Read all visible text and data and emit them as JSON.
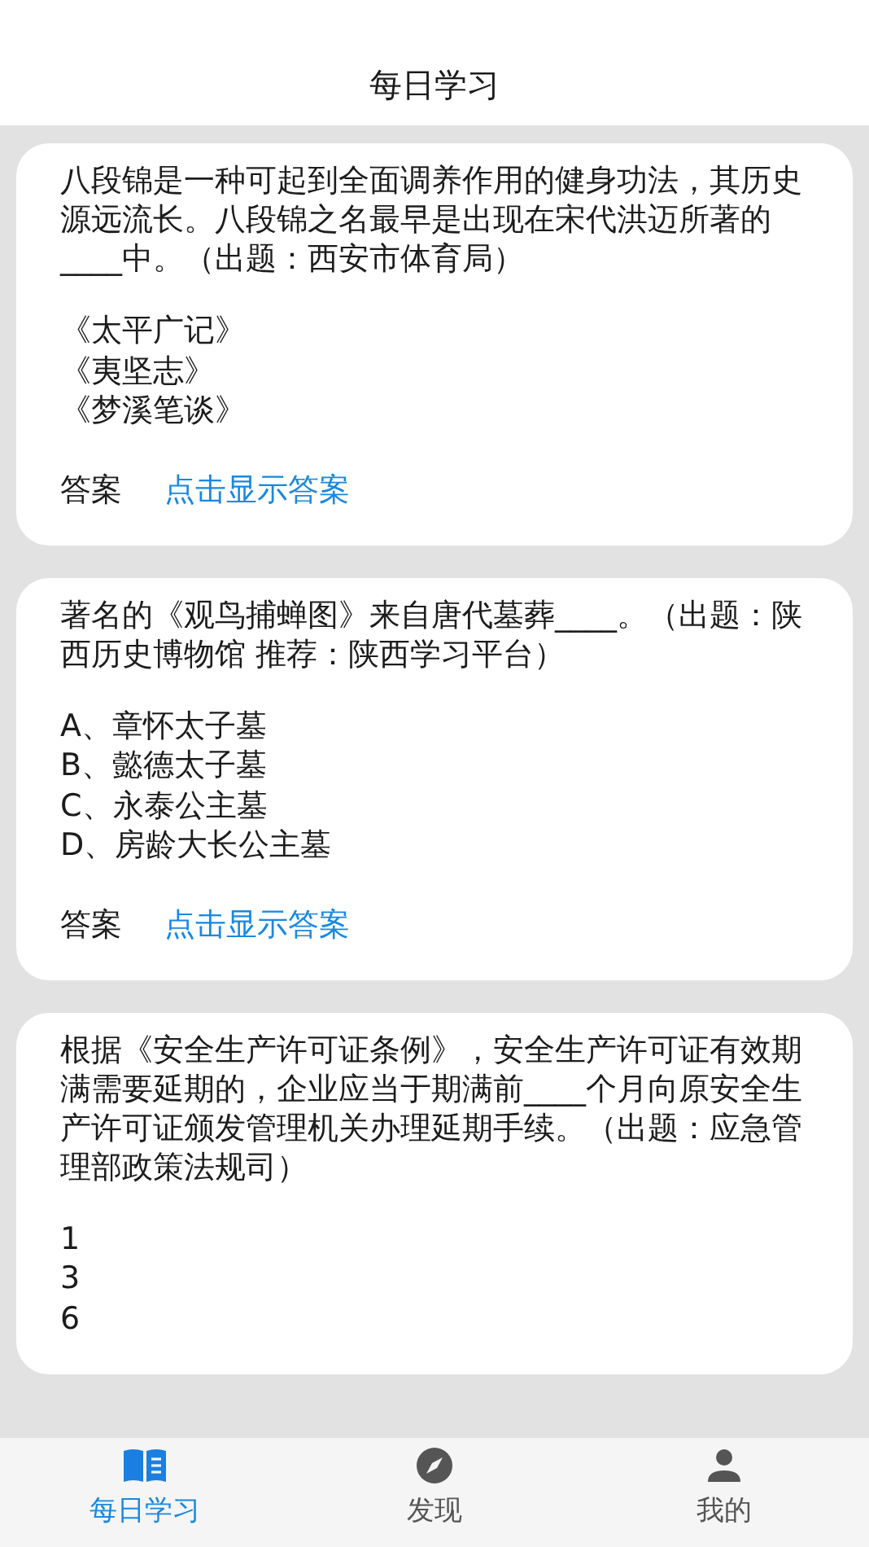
{
  "header": {
    "title": "每日学习"
  },
  "questions": [
    {
      "question": "八段锦是一种可起到全面调养作用的健身功法，其历史源远流长。八段锦之名最早是出现在宋代洪迈所著的____中。（出题：西安市体育局）",
      "options": [
        "《太平广记》",
        "《夷坚志》",
        "《梦溪笔谈》"
      ],
      "answer_label": "答案",
      "reveal_link": "点击显示答案"
    },
    {
      "question": "著名的《观鸟捕蝉图》来自唐代墓葬____。（出题：陕西历史博物馆  推荐：陕西学习平台）",
      "options": [
        "A、章怀太子墓",
        "B、懿德太子墓",
        "C、永泰公主墓",
        "D、房龄大长公主墓"
      ],
      "answer_label": "答案",
      "reveal_link": "点击显示答案"
    },
    {
      "question": "根据《安全生产许可证条例》，安全生产许可证有效期满需要延期的，企业应当于期满前____个月向原安全生产许可证颁发管理机关办理延期手续。（出题：应急管理部政策法规司）",
      "options": [
        "1",
        "3",
        "6"
      ]
    }
  ],
  "tabs": [
    {
      "label": "每日学习",
      "selected": true
    },
    {
      "label": "发现",
      "selected": false
    },
    {
      "label": "我的",
      "selected": false
    }
  ]
}
